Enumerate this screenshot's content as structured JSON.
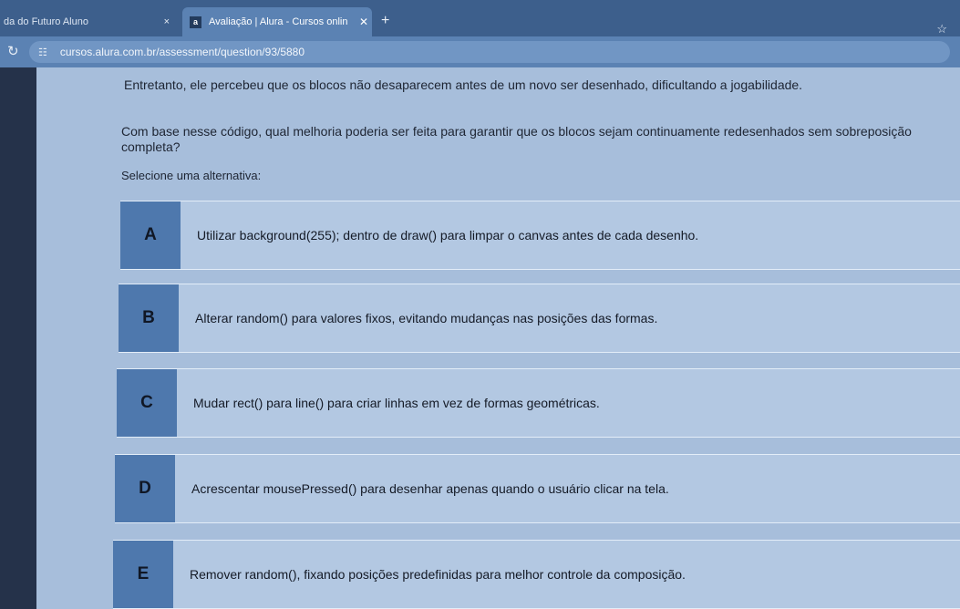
{
  "browser": {
    "tabs": [
      {
        "title": "da do Futuro Aluno",
        "close": "×"
      },
      {
        "favicon": "a",
        "title": "Avaliação | Alura - Cursos onlin",
        "close": "✕"
      }
    ],
    "new_tab": "+",
    "url": "cursos.alura.com.br/assessment/question/93/5880",
    "icons": {
      "reload": "reload-icon",
      "site_settings": "site-settings-icon",
      "bookmark": "star-icon"
    }
  },
  "question": {
    "context": "Entretanto, ele percebeu que os blocos não desaparecem antes de um novo ser desenhado, dificultando a jogabilidade.",
    "prompt": "Com base nesse código, qual melhoria poderia ser feita para garantir que os blocos sejam continuamente redesenhados sem sobreposição completa?",
    "instruction": "Selecione uma alternativa:"
  },
  "options": [
    {
      "letter": "A",
      "text": "Utilizar background(255); dentro de draw() para limpar o canvas antes de cada desenho."
    },
    {
      "letter": "B",
      "text": "Alterar random() para valores fixos, evitando mudanças nas posições das formas."
    },
    {
      "letter": "C",
      "text": "Mudar rect() para line() para criar linhas em vez de formas geométricas."
    },
    {
      "letter": "D",
      "text": "Acrescentar mousePressed() para desenhar apenas quando o usuário clicar na tela."
    },
    {
      "letter": "E",
      "text": "Remover random(), fixando posições predefinidas para melhor controle da composição."
    }
  ],
  "colors": {
    "accent": "#4e78ad",
    "option_bg": "#b3c8e2",
    "chrome": "#5b82b3"
  }
}
